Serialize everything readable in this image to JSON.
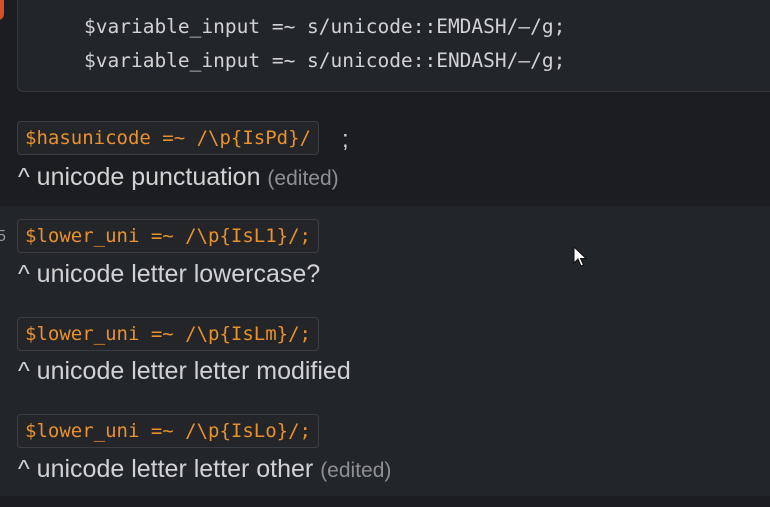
{
  "code_block": {
    "lines": [
      "$variable_input =~ s/unicode::EMDASH/–/g;",
      "$variable_input =~ s/unicode::ENDASH/–/g;"
    ]
  },
  "messages": [
    {
      "code": "$hasunicode =~ /\\p{IsPd}/",
      "trailing": ";",
      "caption": "^ unicode punctuation",
      "edited": "(edited)"
    },
    {
      "code": "$lower_uni =~ /\\p{IsL1}/;",
      "caption": "^ unicode letter lowercase?"
    },
    {
      "code": "$lower_uni =~ /\\p{IsLm}/;",
      "caption": "^ unicode letter letter modified"
    },
    {
      "code": "$lower_uni =~ /\\p{IsLo}/;",
      "caption": "^ unicode letter letter other",
      "edited": "(edited)"
    }
  ],
  "edge_text": "5",
  "colors": {
    "background": "#1b1d21",
    "hover_background": "#222529",
    "code_text": "#d1d2d3",
    "inline_code_text": "#e8912d",
    "edited_text": "#8d8f93",
    "badge": "#d4512b"
  },
  "icons": {
    "cursor": "mouse-pointer-icon"
  }
}
